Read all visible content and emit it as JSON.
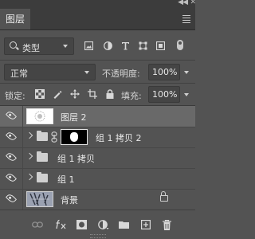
{
  "panel": {
    "tab_label": "图层",
    "collapse_glyph": "◀◀",
    "close_glyph": "✕"
  },
  "filter": {
    "kind_label": "类型"
  },
  "blend": {
    "mode": "正常",
    "opacity_label": "不透明度:",
    "opacity_value": "100%"
  },
  "lock": {
    "label": "锁定:",
    "fill_label": "填充:",
    "fill_value": "100%"
  },
  "layers": [
    {
      "name": "图层 2",
      "selected": true
    },
    {
      "name": "组 1 拷贝 2",
      "selected": false
    },
    {
      "name": "组 1 拷贝",
      "selected": false
    },
    {
      "name": "组 1",
      "selected": false
    },
    {
      "name": "背景",
      "selected": false,
      "locked": true
    }
  ],
  "bottom_icons": [
    "link-icon",
    "fx-icon",
    "add-mask-icon",
    "adjustment-layer-icon",
    "new-group-icon",
    "new-layer-icon",
    "trash-icon"
  ],
  "colors": {
    "panel_bg": "#535353",
    "selected_row": "#696969",
    "header_bg": "#3c3c3c"
  }
}
